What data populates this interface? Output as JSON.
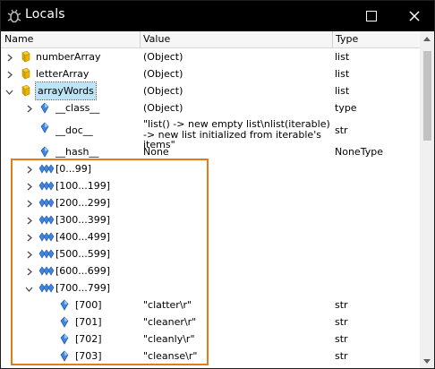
{
  "window": {
    "title": "Locals"
  },
  "columns": {
    "name": "Name",
    "value": "Value",
    "type": "Type"
  },
  "rows": [
    {
      "name": "numberArray",
      "value": "(Object)",
      "type": "list",
      "toggle": "collapsed",
      "icon": "object-icon",
      "level": 0
    },
    {
      "name": "letterArray",
      "value": "(Object)",
      "type": "list",
      "toggle": "collapsed",
      "icon": "object-icon",
      "level": 0
    },
    {
      "name": "arrayWords",
      "value": "(Object)",
      "type": "list",
      "toggle": "expanded",
      "icon": "object-icon",
      "level": 0,
      "selected": true
    },
    {
      "name": "__class__",
      "value": "(Object)",
      "type": "type",
      "toggle": "collapsed",
      "icon": "field-icon",
      "level": 1
    },
    {
      "name": "__doc__",
      "value": "\"list() -> new empty list\\nlist(iterable) -> new list initialized from iterable's items\"",
      "type": "str",
      "toggle": "none",
      "icon": "field-icon",
      "level": 1,
      "tall": true
    },
    {
      "name": "__hash__",
      "value": "None",
      "type": "NoneType",
      "toggle": "none",
      "icon": "field-icon",
      "level": 1
    },
    {
      "name": "[0...99]",
      "value": "",
      "type": "",
      "toggle": "collapsed",
      "icon": "range-icon",
      "level": 1
    },
    {
      "name": "[100...199]",
      "value": "",
      "type": "",
      "toggle": "collapsed",
      "icon": "range-icon",
      "level": 1
    },
    {
      "name": "[200...299]",
      "value": "",
      "type": "",
      "toggle": "collapsed",
      "icon": "range-icon",
      "level": 1
    },
    {
      "name": "[300...399]",
      "value": "",
      "type": "",
      "toggle": "collapsed",
      "icon": "range-icon",
      "level": 1
    },
    {
      "name": "[400...499]",
      "value": "",
      "type": "",
      "toggle": "collapsed",
      "icon": "range-icon",
      "level": 1
    },
    {
      "name": "[500...599]",
      "value": "",
      "type": "",
      "toggle": "collapsed",
      "icon": "range-icon",
      "level": 1
    },
    {
      "name": "[600...699]",
      "value": "",
      "type": "",
      "toggle": "collapsed",
      "icon": "range-icon",
      "level": 1
    },
    {
      "name": "[700...799]",
      "value": "",
      "type": "",
      "toggle": "expanded",
      "icon": "range-icon",
      "level": 1
    },
    {
      "name": "[700]",
      "value": "\"clatter\\r\"",
      "type": "str",
      "toggle": "none",
      "icon": "field-icon",
      "level": 2
    },
    {
      "name": "[701]",
      "value": "\"cleaner\\r\"",
      "type": "str",
      "toggle": "none",
      "icon": "field-icon",
      "level": 2
    },
    {
      "name": "[702]",
      "value": "\"cleanly\\r\"",
      "type": "str",
      "toggle": "none",
      "icon": "field-icon",
      "level": 2
    },
    {
      "name": "[703]",
      "value": "\"cleanse\\r\"",
      "type": "str",
      "toggle": "none",
      "icon": "field-icon",
      "level": 2
    }
  ],
  "colors": {
    "highlight": "#e07c1a",
    "selection": "#bde4f6",
    "object_icon": "#e8b400",
    "field_icon": "#1e63c9"
  }
}
